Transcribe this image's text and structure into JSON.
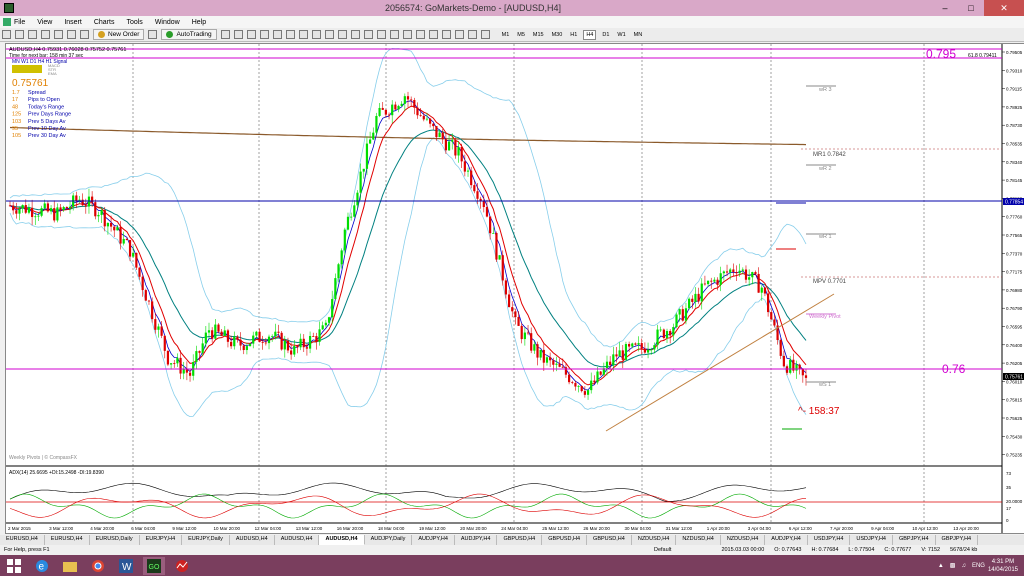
{
  "window": {
    "title": "2056574: GoMarkets-Demo - [AUDUSD,H4]"
  },
  "menu": [
    "File",
    "View",
    "Insert",
    "Charts",
    "Tools",
    "Window",
    "Help"
  ],
  "toolbar": {
    "new_order": "New Order",
    "autotrading": "AutoTrading",
    "timeframes": [
      "M1",
      "M5",
      "M15",
      "M30",
      "H1",
      "H4",
      "D1",
      "W1",
      "MN"
    ],
    "active_timeframe": "H4"
  },
  "chart": {
    "header": "AUDUSD,H4  0.75931 0.76028 0.75752 0.75761",
    "timer_label": "Time for next bar: 158 min 37 sec",
    "tf_row": "MN  W1  D1  H4  H1  Signal",
    "indicators": [
      "MACD",
      "STR",
      "EMA"
    ],
    "price_big": "0.75761",
    "stats": [
      {
        "value": "1.7",
        "label": "Spread"
      },
      {
        "value": "17",
        "label": "Pips to Open"
      },
      {
        "value": "48",
        "label": "Today's Range"
      },
      {
        "value": "125",
        "label": "Prev Days Range"
      },
      {
        "value": "103",
        "label": "Prev 5 Days Av"
      },
      {
        "value": "95",
        "label": "Prev 10 Day Av"
      },
      {
        "value": "105",
        "label": "Prev 30 Day Av"
      }
    ],
    "fib_label": "61.8  0.79411",
    "levels": {
      "l795": "0.795",
      "l76": "0.76",
      "wr3": "wR 3",
      "mr1": "MR1  0.7842",
      "wr2": "wR 2",
      "wr1": "wR 1",
      "mpv": "MPV  0.7701",
      "weekly_pivot": "Weekly Pivot",
      "ws1": "wS 1"
    },
    "countdown": "^- 158:37",
    "source_label": "Weekly Pivots | © CompassFX",
    "adx_label": "ADX(14) 25.6695 +DI:15.2498 -DI:19.8390",
    "price_axis": [
      "0.79505",
      "0.79310",
      "0.79115",
      "0.78925",
      "0.78730",
      "0.78535",
      "0.78340",
      "0.78145",
      "0.77955",
      "0.77760",
      "0.77565",
      "0.77370",
      "0.77175",
      "0.76980",
      "0.76790",
      "0.76595",
      "0.76400",
      "0.76205",
      "0.76010",
      "0.75815",
      "0.75625",
      "0.75430",
      "0.75235"
    ],
    "current_price_tag": "0.75761",
    "pivot_price_tag": "0.77854",
    "adx_axis": [
      "73",
      "35",
      "20.0000",
      "17",
      "0"
    ],
    "time_axis": [
      "2 Mar 2015",
      "3 Mar 12:00",
      "4 Mar 20:00",
      "6 Mar 04:00",
      "9 Mar 12:00",
      "10 Mar 20:00",
      "12 Mar 04:00",
      "13 Mar 12:00",
      "16 Mar 20:00",
      "18 Mar 04:00",
      "19 Mar 12:00",
      "20 Mar 20:00",
      "24 Mar 04:00",
      "25 Mar 12:00",
      "26 Mar 20:00",
      "30 Mar 04:00",
      "31 Mar 12:00",
      "1 Apr 20:00",
      "3 Apr 04:00",
      "6 Apr 12:00",
      "7 Apr 20:00",
      "9 Apr 04:00",
      "10 Apr 12:00",
      "13 Apr 20:00"
    ]
  },
  "tabs": [
    "EURUSD,H4",
    "EURUSD,H4",
    "EURUSD,Daily",
    "EURJPY,H4",
    "EURJPY,Daily",
    "AUDUSD,H4",
    "AUDUSD,H4",
    "AUDUSD,H4",
    "AUDJPY,Daily",
    "AUDJPY,H4",
    "AUDJPY,H4",
    "GBPUSD,H4",
    "GBPUSD,H4",
    "GBPUSD,H4",
    "NZDUSD,H4",
    "NZDUSD,H4",
    "NZDUSD,H4",
    "AUDJPY,H4",
    "USDJPY,H4",
    "USDJPY,H4",
    "GBPJPY,H4",
    "GBPJPY,H4"
  ],
  "active_tab_index": 7,
  "status": {
    "help": "For Help, press F1",
    "profile": "Default",
    "datetime": "2015.03.03 00:00",
    "open": "O: 0.77643",
    "high": "H: 0.77684",
    "low": "L: 0.77504",
    "close": "C: 0.77677",
    "volume": "V: 7152",
    "traffic": "5678/24 kb"
  },
  "taskbar": {
    "time": "4:31 PM",
    "date": "14/04/2015",
    "lang": "ENG"
  },
  "colors": {
    "bull": "#00dd00",
    "bear": "#dd0000",
    "ema_fast": "#0000cc",
    "ema_mid": "#e00000",
    "ema_slow": "#008080",
    "ma200": "#8b5a2b",
    "bollinger": "#87ceeb",
    "magenta": "#d000d0"
  }
}
